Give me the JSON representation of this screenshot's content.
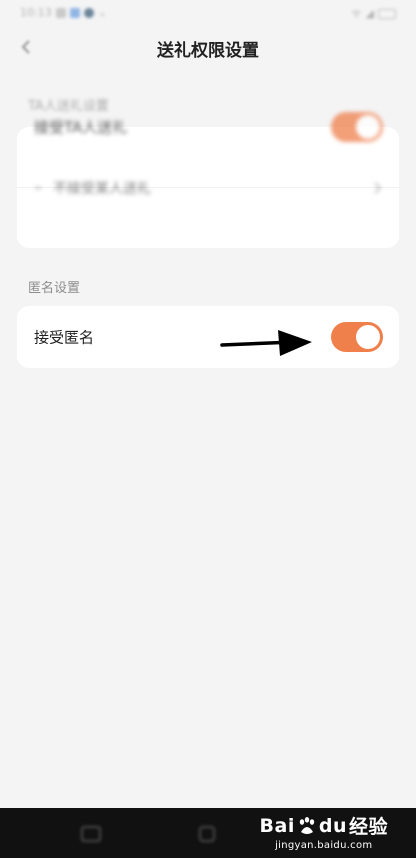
{
  "status_bar": {
    "time": "10:13"
  },
  "nav": {
    "title": "送礼权限设置"
  },
  "sections": {
    "ta_gift": {
      "label": "TA人送礼设置",
      "rows": {
        "accept": {
          "label": "接受TA人送礼",
          "enabled": true
        },
        "exclude": {
          "label": "不接受某人送礼"
        }
      }
    },
    "anonymous": {
      "label": "匿名设置",
      "rows": {
        "accept": {
          "label": "接受匿名",
          "enabled": true
        }
      }
    }
  },
  "watermark": {
    "brand_left": "Bai",
    "brand_mid": "du",
    "brand_right": "经验",
    "url": "jingyan.baidu.com"
  },
  "colors": {
    "toggle_on": "#ef7f4b",
    "background": "#f4f4f5",
    "bottom_bar": "#111111"
  }
}
